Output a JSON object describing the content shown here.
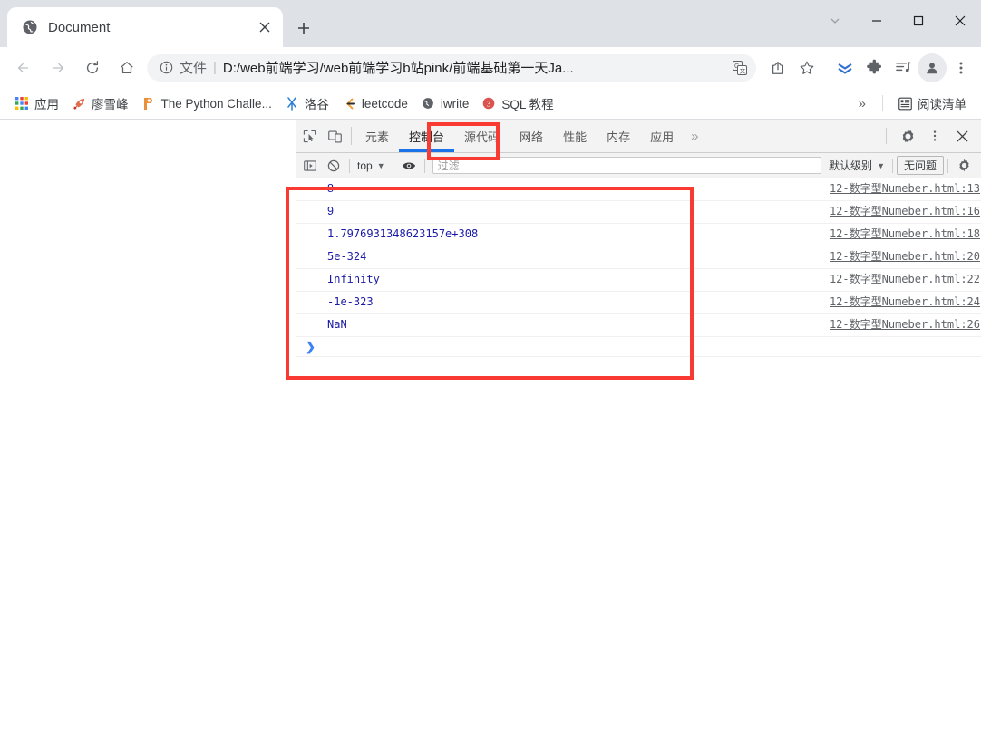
{
  "window": {
    "controls": {
      "dropdown": "chevron-down",
      "minimize": "minimize",
      "maximize": "maximize",
      "close": "close"
    }
  },
  "tabstrip": {
    "tab": {
      "title": "Document",
      "favicon": "globe-icon",
      "close_label": "×"
    },
    "new_tab_label": "+"
  },
  "toolbar": {
    "back": "←",
    "forward": "→",
    "reload": "reload-icon",
    "home": "home-icon",
    "omnibox": {
      "info_icon": "info-circle-icon",
      "scheme": "文件",
      "separator": "|",
      "url": "D:/web前端学习/web前端学习b站pink/前端基础第一天Ja...",
      "translate_icon": "translate-icon",
      "share_icon": "share-icon",
      "bookmark_icon": "star-icon"
    },
    "extensions": [
      {
        "name": "downloads-extension-icon",
        "color": "#2f6fd0"
      },
      {
        "name": "puzzle-extension-icon",
        "color": "#5f6368"
      },
      {
        "name": "music-list-icon",
        "color": "#5f6368"
      }
    ],
    "profile": "avatar-icon",
    "menu": "kebab-menu-icon"
  },
  "bookmarks": {
    "items": [
      {
        "label": "应用",
        "icon": "apps-grid-icon"
      },
      {
        "label": "廖雪峰",
        "icon": "rocket-icon"
      },
      {
        "label": "The Python Challe...",
        "icon": "python-icon"
      },
      {
        "label": "洛谷",
        "icon": "luogu-icon"
      },
      {
        "label": "leetcode",
        "icon": "leetcode-icon"
      },
      {
        "label": "iwrite",
        "icon": "globe-icon"
      },
      {
        "label": "SQL 教程",
        "icon": "sql-icon"
      }
    ],
    "overflow_label": "»",
    "reading_list": {
      "label": "阅读清单",
      "icon": "reading-list-icon"
    }
  },
  "devtools": {
    "inspect_icon": "inspect-element-icon",
    "device_icon": "device-toolbar-icon",
    "tabs": [
      {
        "label": "元素",
        "active": false
      },
      {
        "label": "控制台",
        "active": true
      },
      {
        "label": "源代码",
        "active": false
      },
      {
        "label": "网络",
        "active": false
      },
      {
        "label": "性能",
        "active": false
      },
      {
        "label": "内存",
        "active": false
      },
      {
        "label": "应用",
        "active": false
      }
    ],
    "tabs_overflow": "»",
    "settings_icon": "gear-icon",
    "more_icon": "kebab-menu-icon",
    "close_icon": "close-icon",
    "filterbar": {
      "sidebar_icon": "console-sidebar-icon",
      "clear_icon": "clear-console-icon",
      "context": "top",
      "eye_icon": "live-expression-eye-icon",
      "filter_placeholder": "过滤",
      "level": "默认级别",
      "issues": "无问题",
      "settings_icon": "gear-icon"
    },
    "console": {
      "messages": [
        {
          "text": "8",
          "mono": false,
          "source": "12-数字型Numeber.html:13"
        },
        {
          "text": "9",
          "mono": false,
          "source": "12-数字型Numeber.html:16"
        },
        {
          "text": "1.7976931348623157e+308",
          "mono": true,
          "source": "12-数字型Numeber.html:18"
        },
        {
          "text": "5e-324",
          "mono": true,
          "source": "12-数字型Numeber.html:20"
        },
        {
          "text": "Infinity",
          "mono": true,
          "source": "12-数字型Numeber.html:22"
        },
        {
          "text": "-1e-323",
          "mono": true,
          "source": "12-数字型Numeber.html:24"
        },
        {
          "text": "NaN",
          "mono": true,
          "source": "12-数字型Numeber.html:26"
        }
      ],
      "prompt": "❯"
    }
  },
  "annotations": {
    "highlight_color": "#f93a33",
    "boxes": [
      {
        "name": "console-output-highlight"
      },
      {
        "name": "console-tab-highlight"
      }
    ]
  }
}
